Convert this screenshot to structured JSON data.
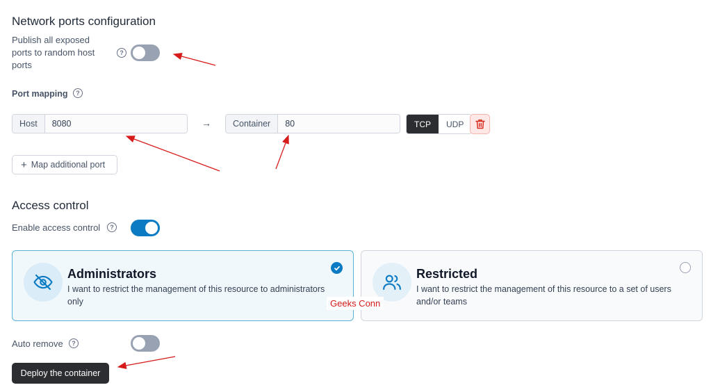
{
  "network": {
    "title": "Network ports configuration",
    "publish_label": "Publish all exposed ports to random host ports",
    "publish_enabled": false,
    "port_mapping_label": "Port mapping",
    "host_addon": "Host",
    "host_value": "8080",
    "container_addon": "Container",
    "container_value": "80",
    "arrow": "→",
    "protocols": [
      "TCP",
      "UDP"
    ],
    "selected_protocol": "TCP",
    "map_additional_label": "Map additional port",
    "map_additional_plus": "+"
  },
  "access": {
    "title": "Access control",
    "enable_label": "Enable access control",
    "enable_enabled": true,
    "cards": [
      {
        "title": "Administrators",
        "description": "I want to restrict the management of this resource to administrators only",
        "icon": "eye-off-icon",
        "selected": true
      },
      {
        "title": "Restricted",
        "description": "I want to restrict the management of this resource to a set of users and/or teams",
        "icon": "users-icon",
        "selected": false
      }
    ]
  },
  "auto_remove": {
    "label": "Auto remove",
    "enabled": false
  },
  "deploy_label": "Deploy the container",
  "watermark": "Geeks Conn",
  "colors": {
    "accent": "#0b7bc4",
    "annotation": "#d71a1a",
    "dark_button": "#2b2d31",
    "danger": "#d92d20"
  }
}
